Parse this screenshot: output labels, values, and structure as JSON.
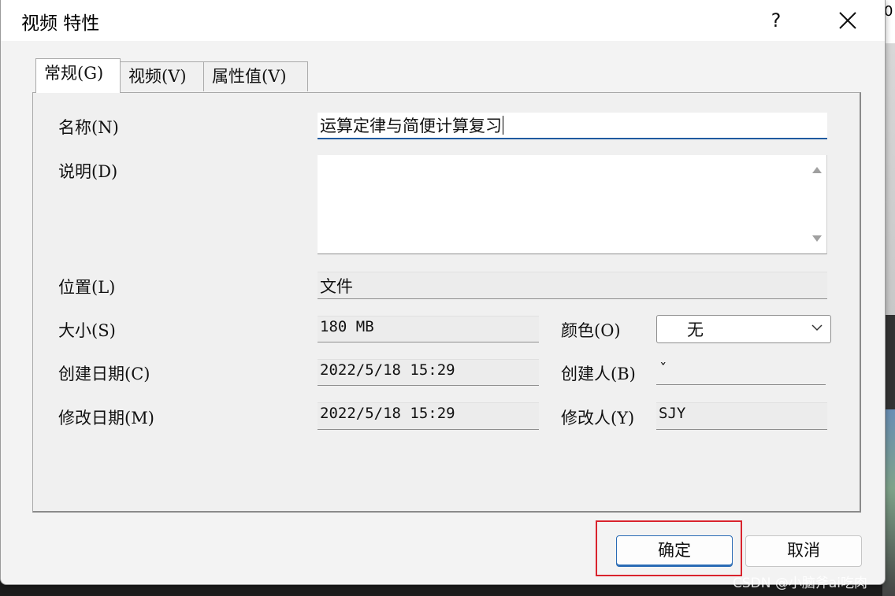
{
  "window": {
    "title": "视频 特性",
    "help_label": "?"
  },
  "tabs": [
    {
      "label": "常规(G)"
    },
    {
      "label": "视频(V)"
    },
    {
      "label": "属性值(V)"
    }
  ],
  "form": {
    "name_label": "名称(N)",
    "name_value": "运算定律与简便计算复习",
    "description_label": "说明(D)",
    "description_value": "",
    "location_label": "位置(L)",
    "location_value": "文件",
    "size_label": "大小(S)",
    "size_value": "180 MB",
    "color_label": "颜色(O)",
    "color_value": "无",
    "created_date_label": "创建日期(C)",
    "created_date_value": "2022/5/18 15:29",
    "creator_label": "创建人(B)",
    "creator_value": "ˇ",
    "modified_date_label": "修改日期(M)",
    "modified_date_value": "2022/5/18 15:29",
    "modifier_label": "修改人(Y)",
    "modifier_value": "SJY"
  },
  "buttons": {
    "ok_label": "确定",
    "cancel_label": "取消"
  },
  "background": {
    "corner_digit": "0"
  },
  "watermark": "CSDN @小脑斧ai吃肉",
  "colors": {
    "highlight_box": "#d9232d",
    "input_focus": "#1f5aa0"
  }
}
